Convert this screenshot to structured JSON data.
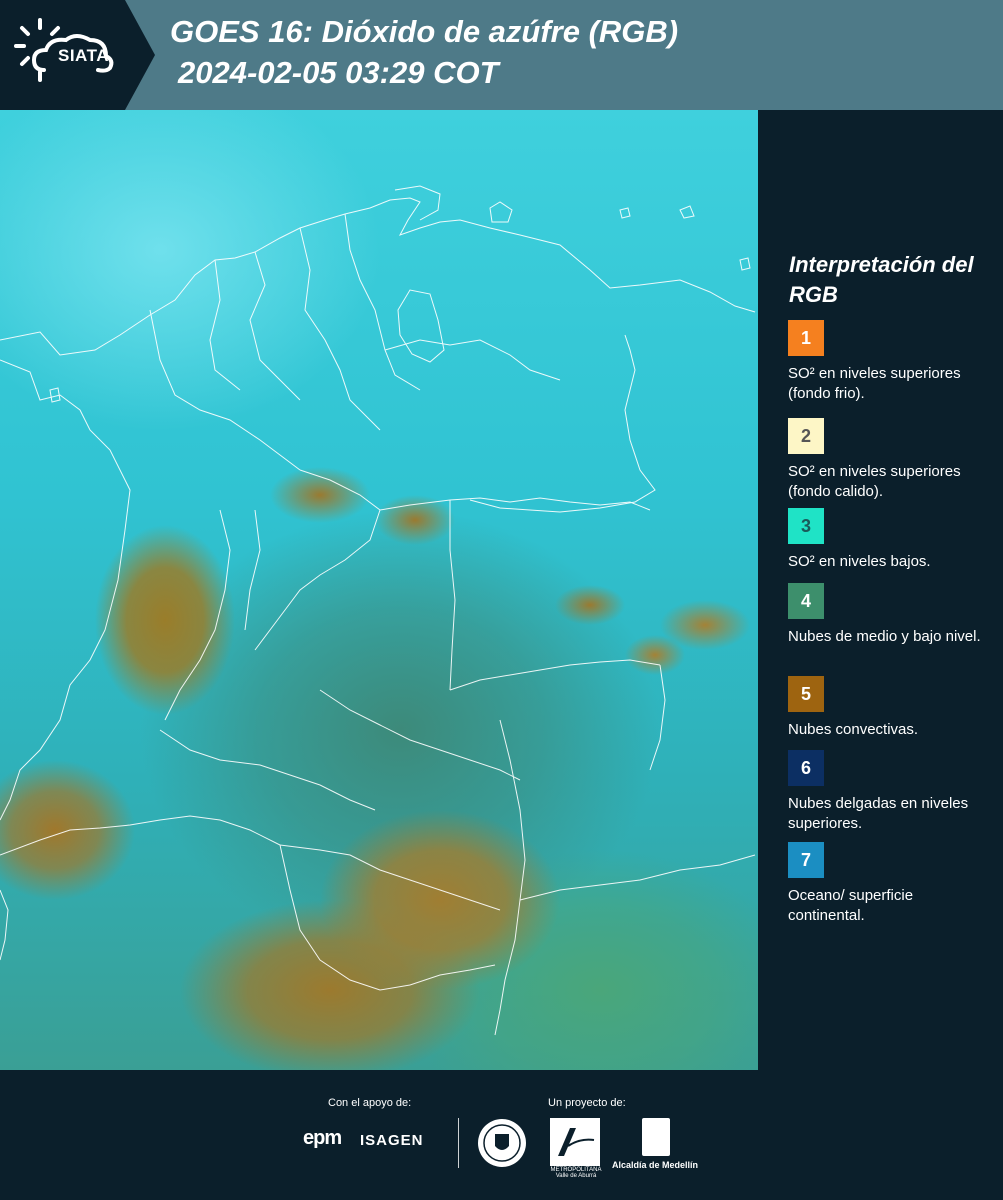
{
  "header": {
    "logo_text": "SIATA",
    "title_line1": "GOES 16: Dióxido de azúfre (RGB)",
    "title_line2": "2024-02-05 03:29 COT",
    "background_color": "#4e7a88"
  },
  "legend": {
    "title": "Interpretación del RGB",
    "items": [
      {
        "number": "1",
        "color": "#f5801f",
        "text_color": "#ffffff",
        "label": "SO² en niveles superiores (fondo frio)."
      },
      {
        "number": "2",
        "color": "#fdf6c6",
        "text_color": "#555555",
        "label": "SO² en niveles superiores (fondo calido)."
      },
      {
        "number": "3",
        "color": "#1fe3c6",
        "text_color": "#1a5a5a",
        "label": "SO² en niveles bajos."
      },
      {
        "number": "4",
        "color": "#3d8f6c",
        "text_color": "#ffffff",
        "label": "Nubes de medio y bajo nivel."
      },
      {
        "number": "5",
        "color": "#9e6410",
        "text_color": "#ffffff",
        "label": "Nubes convectivas."
      },
      {
        "number": "6",
        "color": "#0c2f63",
        "text_color": "#ffffff",
        "label": "Nubes delgadas en niveles superiores."
      },
      {
        "number": "7",
        "color": "#1b8ec2",
        "text_color": "#ffffff",
        "label": "Oceano/ superficie continental."
      }
    ]
  },
  "footer": {
    "support_label": "Con el apoyo de:",
    "project_label": "Un proyecto de:",
    "sponsor_epm": "epm",
    "sponsor_isagen": "ISAGEN",
    "metro_text": "METROPOLITANA Valle de Aburrá",
    "alcaldia_text": "Alcaldía de Medellín"
  }
}
